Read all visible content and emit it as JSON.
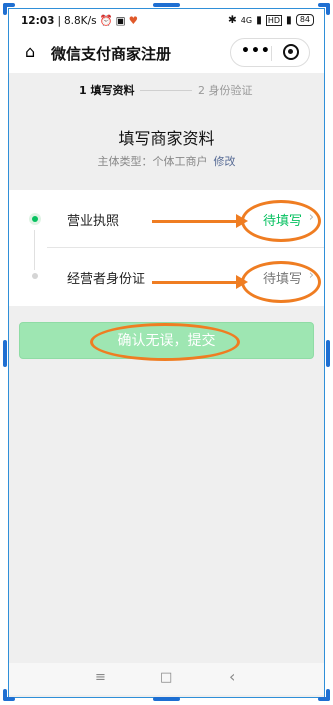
{
  "status_bar": {
    "time": "12:03",
    "speed": "8.8K/s",
    "signal_label": "4G",
    "battery": "84"
  },
  "header": {
    "title": "微信支付商家注册",
    "menu_dots": "•••"
  },
  "steps": [
    {
      "label": "1 填写资料",
      "active": true
    },
    {
      "label": "2 身份验证",
      "active": false
    }
  ],
  "page": {
    "title": "填写商家资料",
    "subject_type": "主体类型：个体工商户",
    "edit_label": "修改"
  },
  "items": [
    {
      "label": "营业执照",
      "status": "待填写",
      "status_color": "#07c160"
    },
    {
      "label": "经营者身份证",
      "status": "待填写",
      "status_color": "#777777"
    }
  ],
  "submit_label": "确认无误，提交",
  "nav": {
    "menu": "≡",
    "home": "□",
    "back": "‹"
  },
  "colors": {
    "accent": "#07c160",
    "submit_disabled": "#9ee6b2",
    "annotation": "#ef7d22",
    "link": "#576b95"
  }
}
